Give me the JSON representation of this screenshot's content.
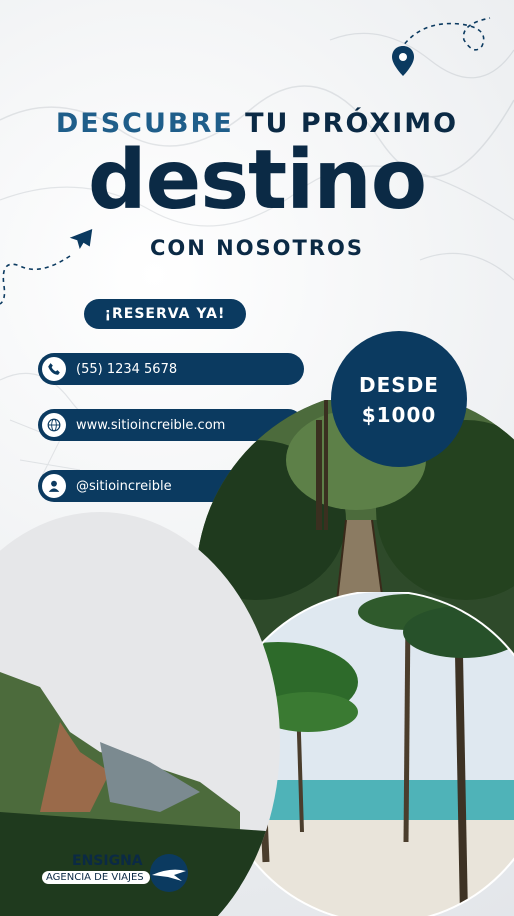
{
  "headline": {
    "word1": "DESCUBRE",
    "word2": "TU PRÓXIMO",
    "big": "destino",
    "sub": "CON NOSOTROS"
  },
  "cta": {
    "label": "¡RESERVA YA!"
  },
  "contacts": [
    {
      "icon": "phone-icon",
      "text": "(55) 1234 5678"
    },
    {
      "icon": "globe-icon",
      "text": "www.sitioincreible.com"
    },
    {
      "icon": "user-icon",
      "text": "@sitioincreible"
    }
  ],
  "price": {
    "line1": "DESDE",
    "line2": "$1000"
  },
  "brand": {
    "name": "ENSIGNA",
    "tagline": "AGENCIA DE VIAJES"
  },
  "colors": {
    "navy": "#0b2a45",
    "accent": "#1f5e8a",
    "pill": "#0b3a60"
  }
}
